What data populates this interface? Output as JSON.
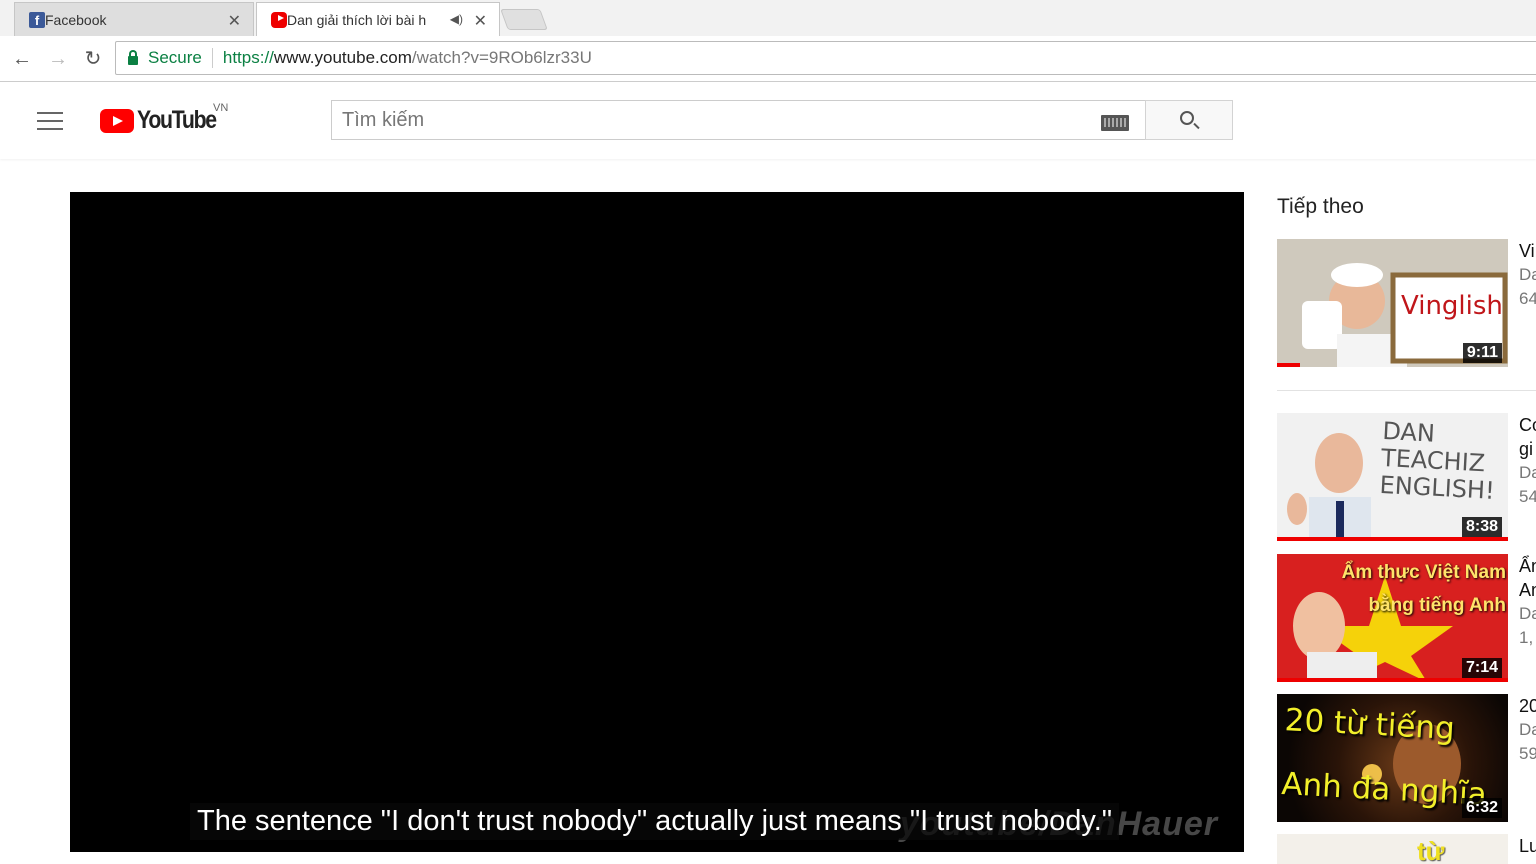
{
  "browser": {
    "tabs": [
      {
        "title": "Facebook",
        "active": false
      },
      {
        "title": "Dan giải thích lời bài h",
        "active": true
      }
    ],
    "secure_label": "Secure",
    "url": {
      "scheme": "https://",
      "host": "www.youtube.com",
      "path": "/watch?v=9ROb6lzr33U"
    }
  },
  "youtube": {
    "logo_text": "YouTube",
    "country_code": "VN",
    "search_placeholder": "Tìm kiếm"
  },
  "player": {
    "caption": "The sentence \"I don't trust nobody\" actually just means \"I trust nobody.\"",
    "watermark": "youtube/DanHauer"
  },
  "up_next": {
    "heading": "Tiếp theo",
    "items": [
      {
        "title": "Vi",
        "channel": "Da",
        "views": "64",
        "duration": "9:11",
        "thumb_text": "Vinglish",
        "watched_fraction": 0.1
      },
      {
        "title": "Co",
        "title2": "gi",
        "channel": "Da",
        "views": "54",
        "duration": "8:38",
        "thumb_text": "DAN TEACHIZ ENGLISH!",
        "watched_fraction": 1.0
      },
      {
        "title": "Ẩn",
        "title2": "An",
        "channel": "Da",
        "views": "1,",
        "duration": "7:14",
        "thumb_text": "Ẩm thực Việt Nam bằng tiếng Anh",
        "watched_fraction": 1.0
      },
      {
        "title": "20",
        "channel": "Da",
        "views": "59",
        "duration": "6:32",
        "thumb_text": "20 từ tiếng Anh đa nghĩa",
        "watched_fraction": 0
      },
      {
        "title": "Lu",
        "duration": "",
        "thumb_text": "từ",
        "watched_fraction": 0
      }
    ]
  }
}
